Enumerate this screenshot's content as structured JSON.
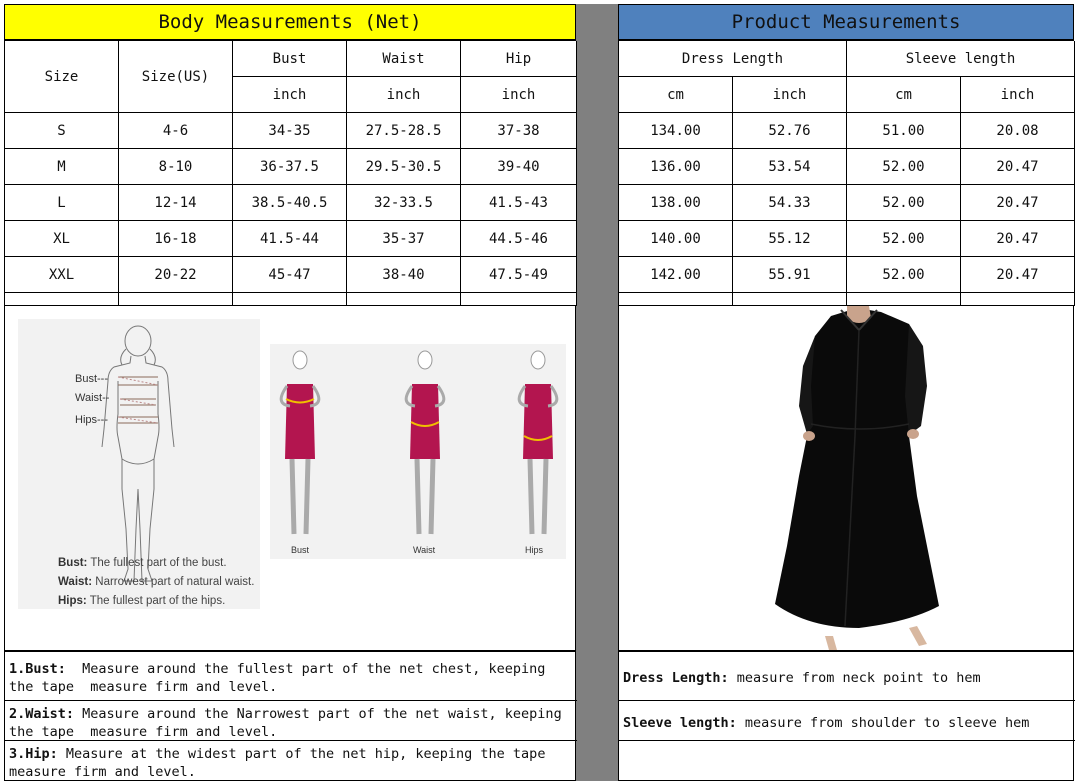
{
  "body_header": "Body Measurements (Net)",
  "product_header": "Product Measurements",
  "body_table": {
    "size_label": "Size",
    "size_us_label": "Size(US)",
    "columns": [
      "Bust",
      "Waist",
      "Hip"
    ],
    "unit": "inch",
    "rows": [
      [
        "S",
        "4-6",
        "34-35",
        "27.5-28.5",
        "37-38"
      ],
      [
        "M",
        "8-10",
        "36-37.5",
        "29.5-30.5",
        "39-40"
      ],
      [
        "L",
        "12-14",
        "38.5-40.5",
        "32-33.5",
        "41.5-43"
      ],
      [
        "XL",
        "16-18",
        "41.5-44",
        "35-37",
        "44.5-46"
      ],
      [
        "XXL",
        "20-22",
        "45-47",
        "38-40",
        "47.5-49"
      ]
    ]
  },
  "product_table": {
    "groups": [
      "Dress Length",
      "Sleeve length"
    ],
    "units": [
      "cm",
      "inch",
      "cm",
      "inch"
    ],
    "rows": [
      [
        "134.00",
        "52.76",
        "51.00",
        "20.08"
      ],
      [
        "136.00",
        "53.54",
        "52.00",
        "20.47"
      ],
      [
        "138.00",
        "54.33",
        "52.00",
        "20.47"
      ],
      [
        "140.00",
        "55.12",
        "52.00",
        "20.47"
      ],
      [
        "142.00",
        "55.91",
        "52.00",
        "20.47"
      ]
    ]
  },
  "figure": {
    "labels": [
      "Bust---",
      "Waist--",
      "Hips---"
    ],
    "defs": [
      {
        "term": "Bust:",
        "text": "The fullest part of the bust."
      },
      {
        "term": "Waist:",
        "text": "Narrowest part of natural waist."
      },
      {
        "term": "Hips:",
        "text": "The fullest part of the hips."
      }
    ],
    "captions": [
      "Bust",
      "Waist",
      "Hips"
    ]
  },
  "notes_left": [
    {
      "term": "1.Bust:",
      "text": "  Measure around the fullest part of the net chest, keeping the tape  measure firm and level."
    },
    {
      "term": "2.Waist:",
      "text": " Measure around the Narrowest part of the net waist, keeping the tape  measure firm and level."
    },
    {
      "term": "3.Hip:",
      "text": " Measure at the widest part of the net hip, keeping the tape measure firm and level."
    }
  ],
  "notes_right": [
    {
      "term": "Dress Length:",
      "text": " measure from neck point to hem"
    },
    {
      "term": "Sleeve length:",
      "text": " measure from shoulder to sleeve hem"
    }
  ],
  "colors": {
    "body_header_bg": "#ffff00",
    "product_header_bg": "#4f81bd",
    "divider": "#808080",
    "dress_fill": "#0a0a0a",
    "model_dress": "#b3154f"
  }
}
